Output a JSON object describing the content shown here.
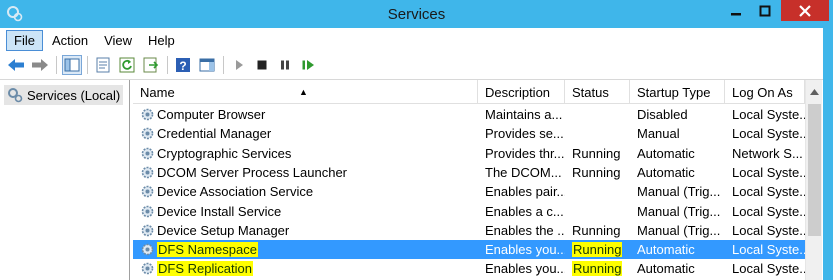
{
  "window": {
    "title": "Services"
  },
  "menu": {
    "items": [
      "File",
      "Action",
      "View",
      "Help"
    ]
  },
  "tree": {
    "root_label": "Services (Local)"
  },
  "columns": {
    "name": "Name",
    "description": "Description",
    "status": "Status",
    "startup_type": "Startup Type",
    "log_on_as": "Log On As"
  },
  "services": [
    {
      "name": "Computer Browser",
      "description": "Maintains a...",
      "status": "",
      "startup": "Disabled",
      "logon": "Local Syste..."
    },
    {
      "name": "Credential Manager",
      "description": "Provides se...",
      "status": "",
      "startup": "Manual",
      "logon": "Local Syste..."
    },
    {
      "name": "Cryptographic Services",
      "description": "Provides thr...",
      "status": "Running",
      "startup": "Automatic",
      "logon": "Network S..."
    },
    {
      "name": "DCOM Server Process Launcher",
      "description": "The DCOM...",
      "status": "Running",
      "startup": "Automatic",
      "logon": "Local Syste..."
    },
    {
      "name": "Device Association Service",
      "description": "Enables pair...",
      "status": "",
      "startup": "Manual (Trig...",
      "logon": "Local Syste..."
    },
    {
      "name": "Device Install Service",
      "description": "Enables a c...",
      "status": "",
      "startup": "Manual (Trig...",
      "logon": "Local Syste..."
    },
    {
      "name": "Device Setup Manager",
      "description": "Enables the ...",
      "status": "Running",
      "startup": "Manual (Trig...",
      "logon": "Local Syste..."
    },
    {
      "name": "DFS Namespace",
      "description": "Enables you...",
      "status": "Running",
      "startup": "Automatic",
      "logon": "Local Syste..."
    },
    {
      "name": "DFS Replication",
      "description": "Enables you...",
      "status": "Running",
      "startup": "Automatic",
      "logon": "Local Syste..."
    }
  ],
  "colors": {
    "title_bar": "#3fb6ea",
    "selection": "#3399ff",
    "highlight": "#ffff00",
    "close_button": "#c7302a"
  }
}
